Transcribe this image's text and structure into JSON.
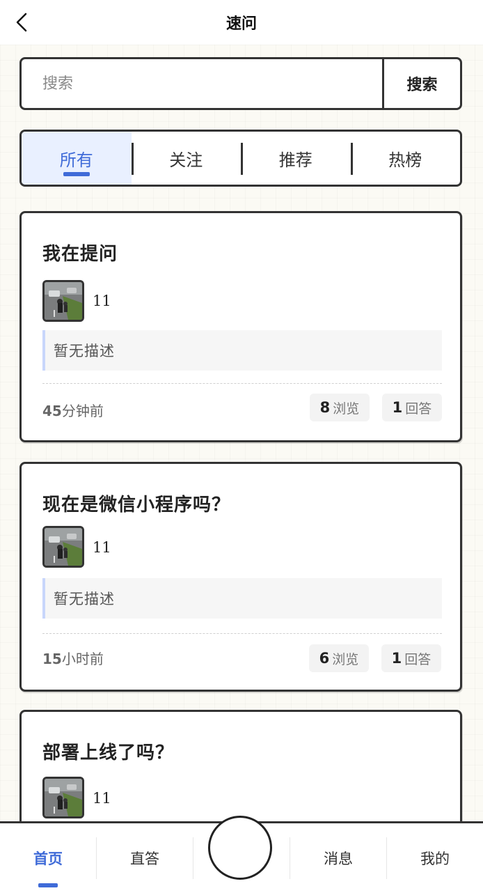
{
  "header": {
    "title": "速问"
  },
  "search": {
    "placeholder": "搜索",
    "button": "搜索"
  },
  "tabs": [
    {
      "label": "所有",
      "active": true
    },
    {
      "label": "关注",
      "active": false
    },
    {
      "label": "推荐",
      "active": false
    },
    {
      "label": "热榜",
      "active": false
    }
  ],
  "posts": [
    {
      "title": "我在提问",
      "user": "11",
      "description": "暂无描述",
      "time_num": "45",
      "time_unit": "分钟前",
      "views": "8",
      "views_label": "浏览",
      "answers": "1",
      "answers_label": "回答"
    },
    {
      "title": "现在是微信小程序吗？",
      "user": "11",
      "description": "暂无描述",
      "time_num": "15",
      "time_unit": "小时前",
      "views": "6",
      "views_label": "浏览",
      "answers": "1",
      "answers_label": "回答"
    },
    {
      "title": "部署上线了吗？",
      "user": "11"
    }
  ],
  "nav": {
    "home": "首页",
    "answer": "直答",
    "messages": "消息",
    "mine": "我的"
  },
  "colors": {
    "accent": "#3f6bd8",
    "border": "#333333",
    "tab_active_bg": "#e9f0ff"
  },
  "icons": {
    "back": "chevron-left-icon",
    "center": "add-circle-button"
  }
}
